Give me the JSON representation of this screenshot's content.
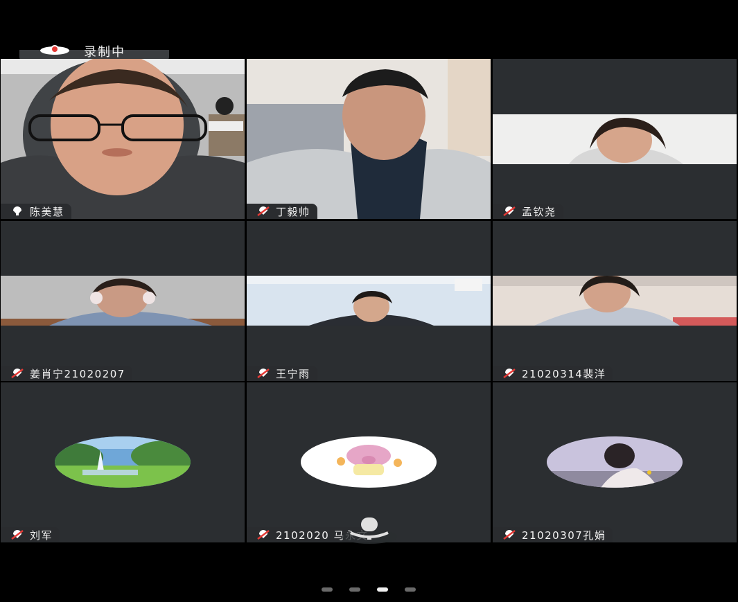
{
  "recording": {
    "label": "录制中",
    "icon": "recording-cloud-icon",
    "color": "#e53935"
  },
  "participants": [
    {
      "name": "陈美慧",
      "mic": "mic-on-icon"
    },
    {
      "name": "丁毅帅",
      "mic": "mic-muted-icon"
    },
    {
      "name": "孟钦尧",
      "mic": "mic-muted-icon"
    },
    {
      "name": "姜肖宁21020207",
      "mic": "mic-muted-icon"
    },
    {
      "name": "王宁雨",
      "mic": "mic-muted-icon"
    },
    {
      "name": "21020314裴洋",
      "mic": "mic-muted-icon"
    },
    {
      "name": "刘军",
      "mic": "mic-muted-icon"
    },
    {
      "name": "2102020 马永文",
      "mic": "mic-muted-icon"
    },
    {
      "name": "21020307孔娟",
      "mic": "mic-muted-icon"
    }
  ],
  "floating_mic": {
    "icon": "microphone-icon"
  },
  "pagination": {
    "pages": 4,
    "current_page": 3
  },
  "colors": {
    "tile_bg": "#2b2e31",
    "background": "#000000",
    "muted_slash": "#e53935"
  }
}
